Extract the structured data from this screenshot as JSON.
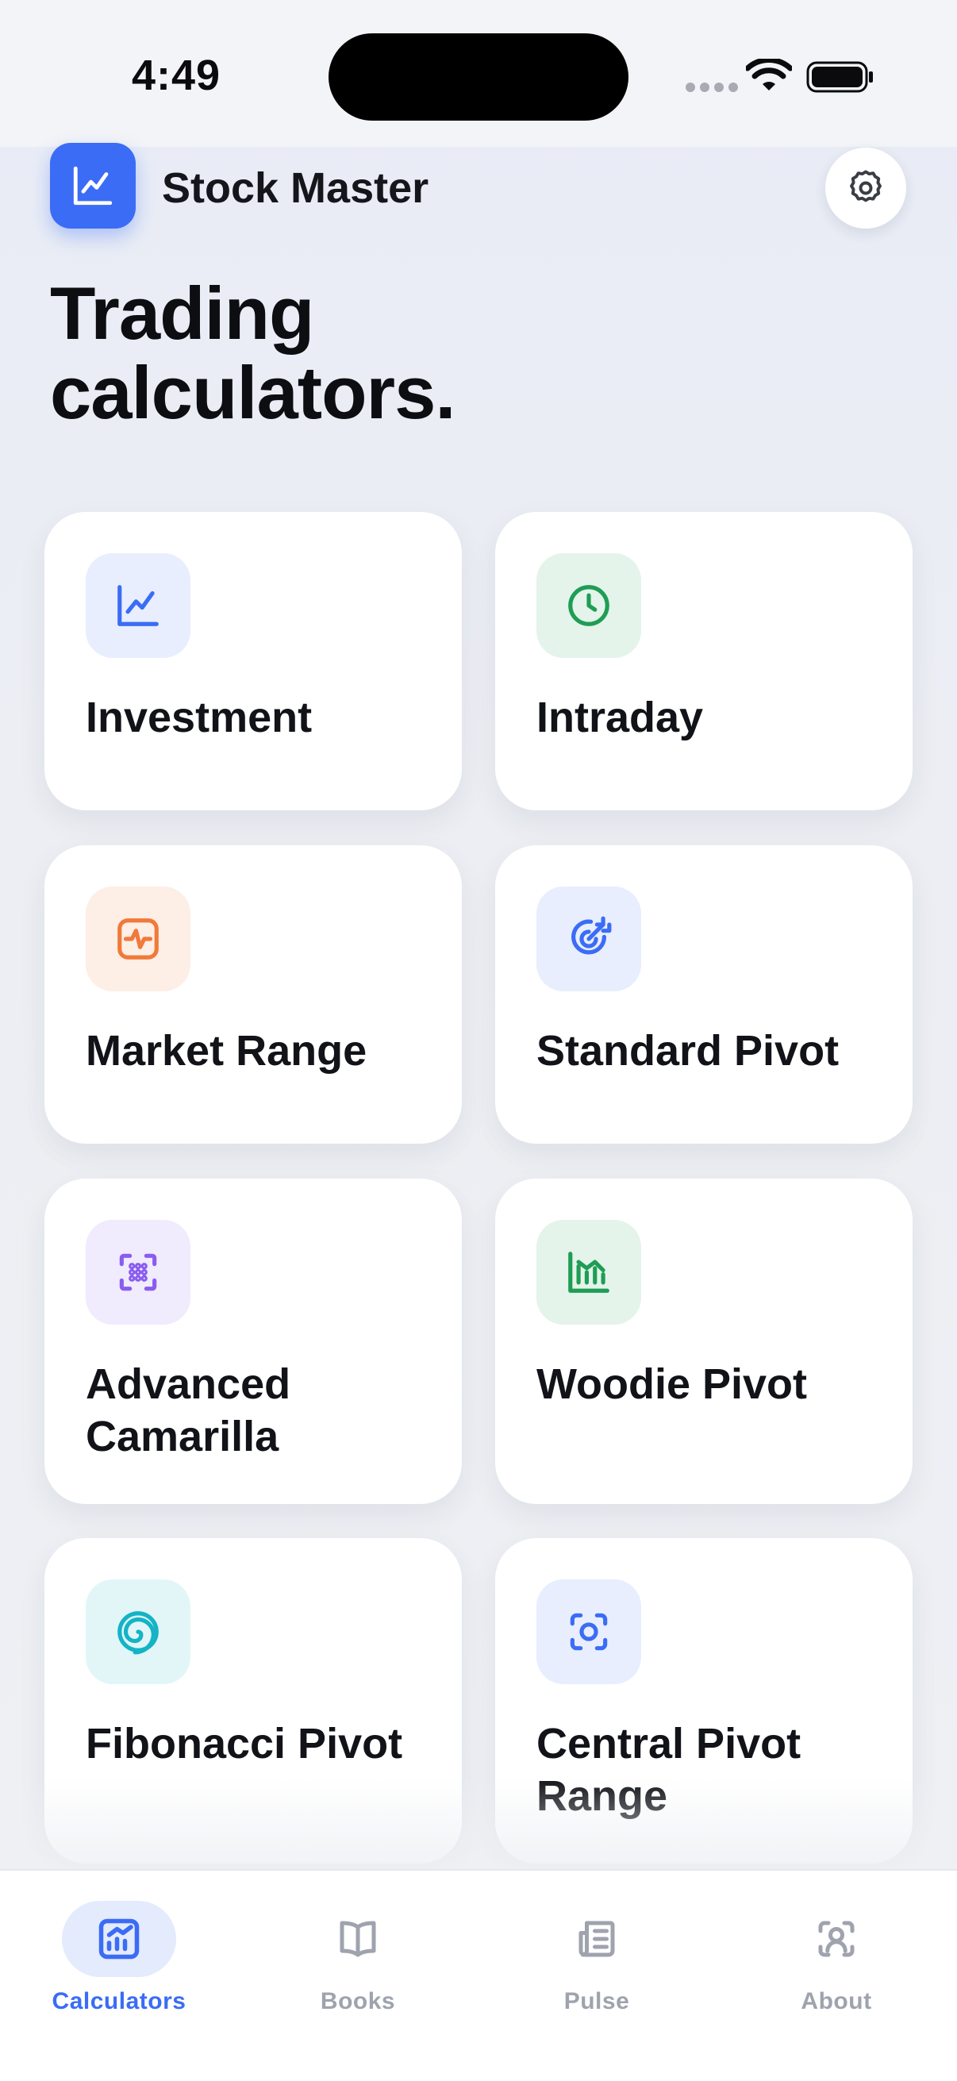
{
  "status_bar": {
    "time": "4:49"
  },
  "header": {
    "app_name": "Stock Master",
    "logo_icon": "trend-chart-icon",
    "settings_icon": "gear-icon"
  },
  "page": {
    "title_line1": "Trading",
    "title_line2": "calculators."
  },
  "cards": [
    {
      "label": "Investment",
      "icon": "trend-chart-icon",
      "icon_color": "#3b6cf6",
      "icon_bg": "#e8eefd"
    },
    {
      "label": "Intraday",
      "icon": "clock-icon",
      "icon_color": "#1f9d55",
      "icon_bg": "#e4f4ea"
    },
    {
      "label": "Market Range",
      "icon": "activity-icon",
      "icon_color": "#f07a3a",
      "icon_bg": "#fdeee6"
    },
    {
      "label": "Standard Pivot",
      "icon": "target-icon",
      "icon_color": "#3b6cf6",
      "icon_bg": "#e8eefd"
    },
    {
      "label": "Advanced Camarilla",
      "icon": "grid-scan-icon",
      "icon_color": "#8a5cf0",
      "icon_bg": "#f0ebfd"
    },
    {
      "label": "Woodie Pivot",
      "icon": "bar-chart-icon",
      "icon_color": "#1f9d55",
      "icon_bg": "#e4f4ea"
    },
    {
      "label": "Fibonacci Pivot",
      "icon": "spiral-icon",
      "icon_color": "#14b3c6",
      "icon_bg": "#e2f6f8"
    },
    {
      "label": "Central Pivot Range",
      "icon": "scan-circle-icon",
      "icon_color": "#3b6cf6",
      "icon_bg": "#e8eefd"
    }
  ],
  "tabs": [
    {
      "label": "Calculators",
      "icon": "calculator-chart-icon",
      "active": true
    },
    {
      "label": "Books",
      "icon": "book-icon",
      "active": false
    },
    {
      "label": "Pulse",
      "icon": "newspaper-icon",
      "active": false
    },
    {
      "label": "About",
      "icon": "user-icon",
      "active": false
    }
  ],
  "colors": {
    "accent": "#3b6cf6",
    "tab_inactive": "#9ea3ad"
  }
}
